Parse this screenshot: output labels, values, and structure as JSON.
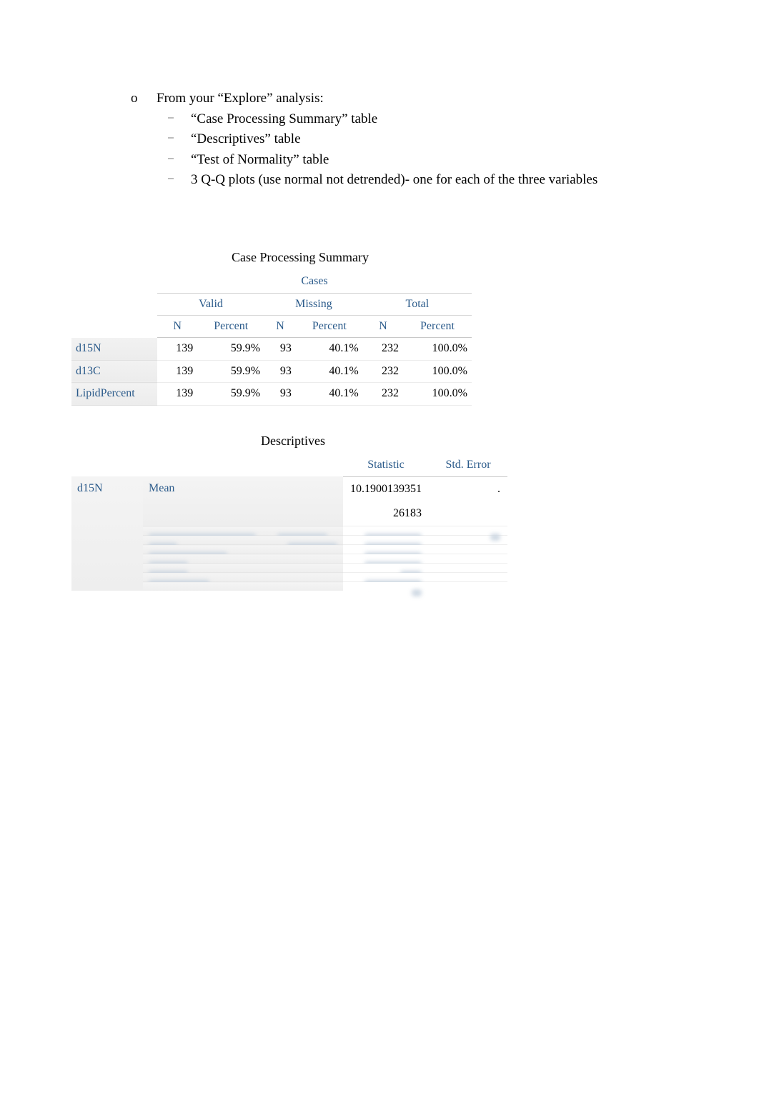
{
  "outer_marker": "o",
  "outer_text": "From your “Explore” analysis:",
  "inner_marker": "⎯",
  "inner_items": [
    "“Case Processing Summary” table",
    "“Descriptives” table",
    "“Test of Normality” table",
    "3 Q-Q plots (use normal not detrended)- one for each of the three variables"
  ],
  "cps": {
    "title": "Case Processing Summary",
    "super": "Cases",
    "groups": [
      "Valid",
      "Missing",
      "Total"
    ],
    "cols": [
      "N",
      "Percent",
      "N",
      "Percent",
      "N",
      "Percent"
    ],
    "rows": [
      {
        "name": "d15N",
        "valid_n": "139",
        "valid_p": "59.9%",
        "miss_n": "93",
        "miss_p": "40.1%",
        "tot_n": "232",
        "tot_p": "100.0%"
      },
      {
        "name": "d13C",
        "valid_n": "139",
        "valid_p": "59.9%",
        "miss_n": "93",
        "miss_p": "40.1%",
        "tot_n": "232",
        "tot_p": "100.0%"
      },
      {
        "name": "LipidPercent",
        "valid_n": "139",
        "valid_p": "59.9%",
        "miss_n": "93",
        "miss_p": "40.1%",
        "tot_n": "232",
        "tot_p": "100.0%"
      }
    ]
  },
  "desc": {
    "title": "Descriptives",
    "col_stat": "Statistic",
    "col_err": "Std. Error",
    "var": "d15N",
    "mean_label": "Mean",
    "mean_stat_top": "10.1900139351",
    "mean_stat_bot": "26183",
    "mean_err": "."
  }
}
